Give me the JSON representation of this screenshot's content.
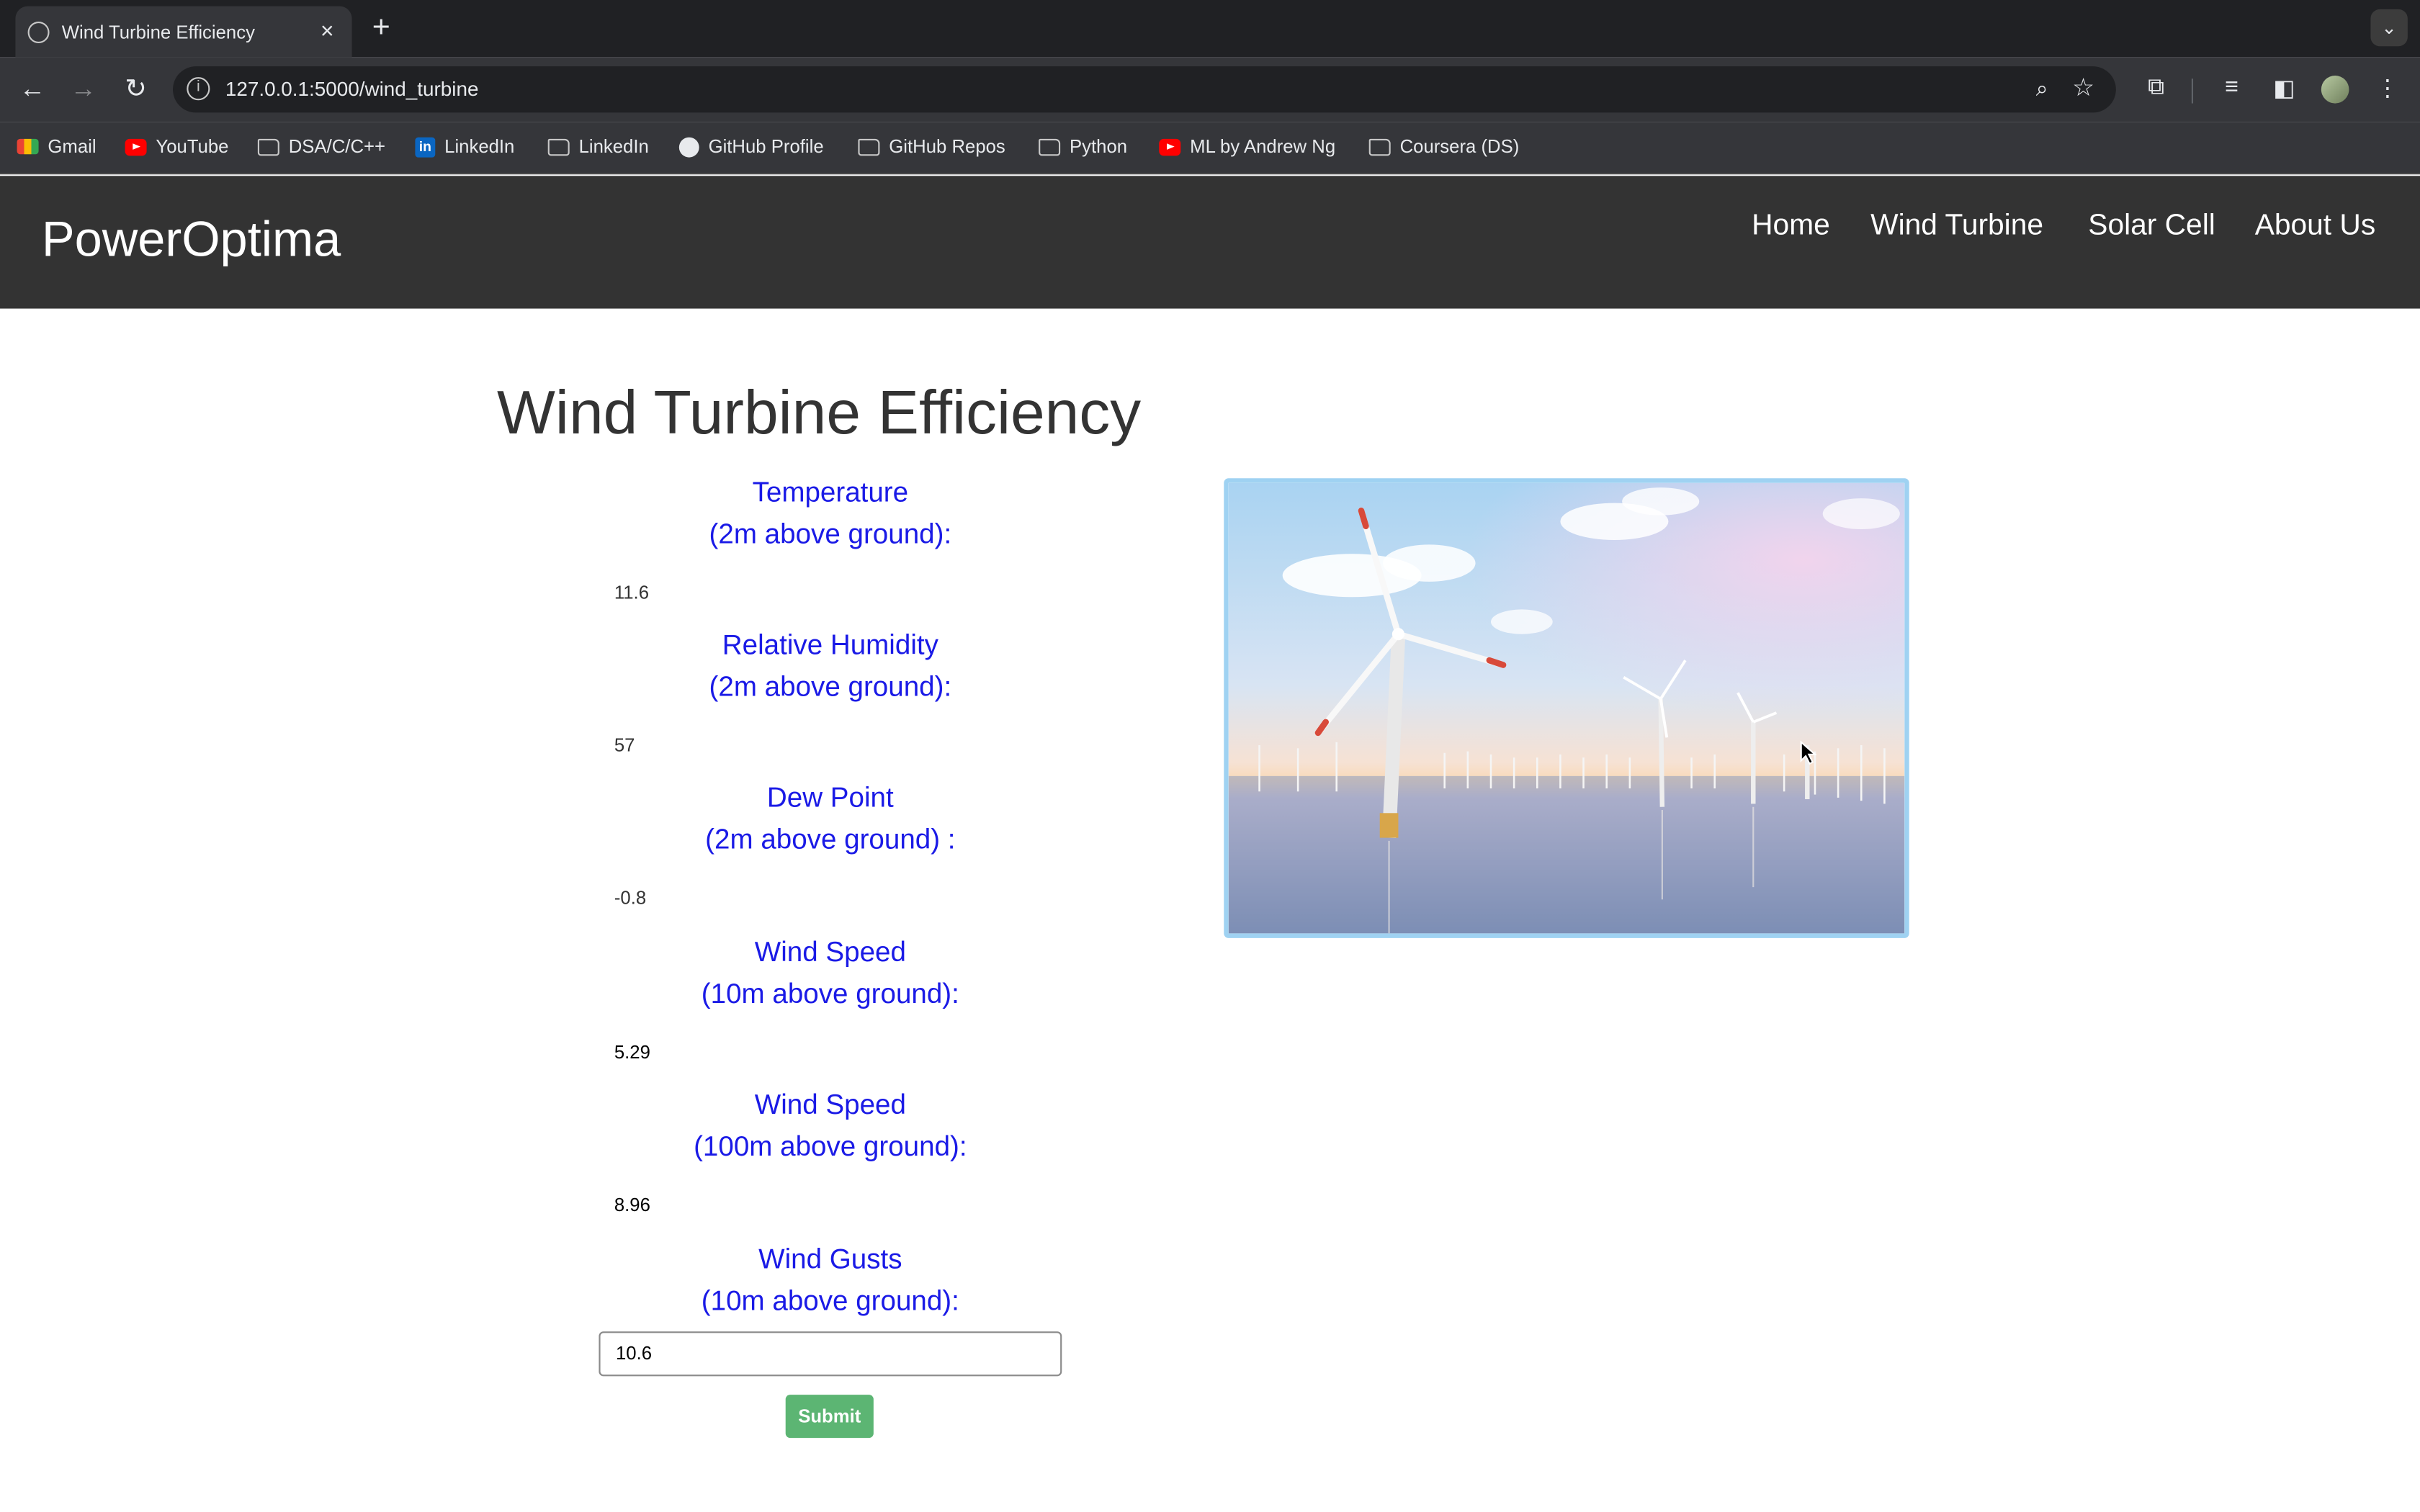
{
  "browser": {
    "tab_title": "Wind Turbine Efficiency",
    "tab_close": "×",
    "new_tab": "+",
    "url": "127.0.0.1:5000/wind_turbine",
    "bookmarks": [
      {
        "label": "Gmail",
        "icon": "gmail-icon"
      },
      {
        "label": "YouTube",
        "icon": "youtube-icon"
      },
      {
        "label": "DSA/C/C++",
        "icon": "folder-icon"
      },
      {
        "label": "LinkedIn",
        "icon": "linkedin-icon"
      },
      {
        "label": "LinkedIn",
        "icon": "folder-icon"
      },
      {
        "label": "GitHub Profile",
        "icon": "github-icon"
      },
      {
        "label": "GitHub Repos",
        "icon": "folder-icon"
      },
      {
        "label": "Python",
        "icon": "folder-icon"
      },
      {
        "label": "ML by Andrew Ng",
        "icon": "youtube-icon"
      },
      {
        "label": "Coursera (DS)",
        "icon": "folder-icon"
      }
    ]
  },
  "site": {
    "brand": "PowerOptima",
    "nav": [
      "Home",
      "Wind Turbine",
      "Solar Cell",
      "About Us"
    ]
  },
  "main": {
    "title": "Wind Turbine Efficiency",
    "fields": [
      {
        "label_line1": "Temperature",
        "label_line2": "(2m above ground):",
        "value": "11.6"
      },
      {
        "label_line1": "Relative Humidity",
        "label_line2": "(2m above ground):",
        "value": "57"
      },
      {
        "label_line1": "Dew Point",
        "label_line2": "(2m above ground) :",
        "value": "-0.8"
      },
      {
        "label_line1": "Wind Speed",
        "label_line2": "(10m above ground):",
        "value": "5.29"
      },
      {
        "label_line1": "Wind Speed",
        "label_line2": "(100m above ground):",
        "value": "8.96"
      },
      {
        "label_line1": "Wind Gusts",
        "label_line2": "(10m above ground):",
        "value": "10.6"
      }
    ],
    "submit_label": "Submit"
  },
  "colors": {
    "header_bg": "#333333",
    "label_blue": "#1a1ae6",
    "submit_green": "#5cb573",
    "image_border": "#9fd2f2"
  }
}
